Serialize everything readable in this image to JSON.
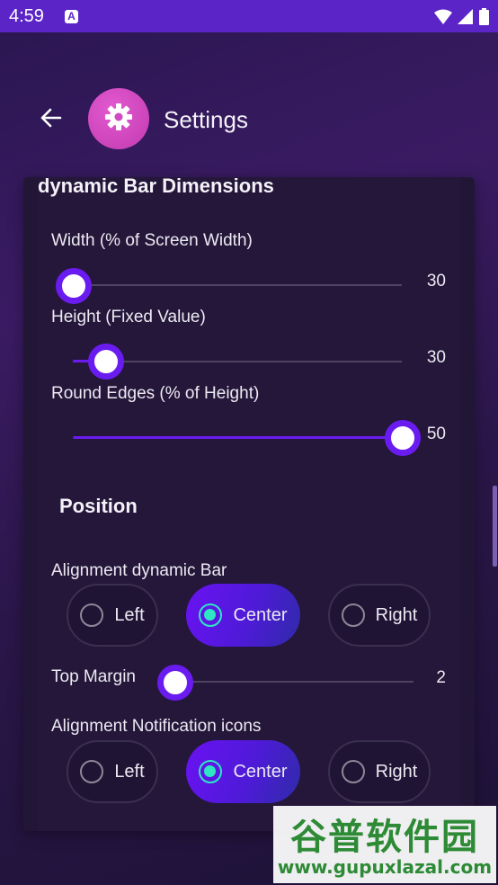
{
  "status_bar": {
    "time": "4:59",
    "notification_icon": "A"
  },
  "app_bar": {
    "title": "Settings"
  },
  "dimensions": {
    "section_title": "dynamic Bar Dimensions",
    "width": {
      "label": "Width (% of Screen Width)",
      "value": "30",
      "fraction": 0.0
    },
    "height": {
      "label": "Height (Fixed Value)",
      "value": "30",
      "fraction": 0.1
    },
    "round_edges": {
      "label": "Round Edges (% of Height)",
      "value": "50",
      "fraction": 1.0
    }
  },
  "position": {
    "section_title": "Position",
    "alignment_bar": {
      "label": "Alignment dynamic Bar",
      "options": [
        "Left",
        "Center",
        "Right"
      ],
      "selected": "Center"
    },
    "top_margin": {
      "label": "Top Margin",
      "value": "2",
      "fraction": 0.0
    },
    "alignment_icons": {
      "label": "Alignment Notification icons",
      "options": [
        "Left",
        "Center",
        "Right"
      ],
      "selected": "Center"
    }
  },
  "watermark": {
    "line1": "谷普软件园",
    "line2": "www.gupuxlazal.com"
  },
  "colors": {
    "accent": "#6a1cf0",
    "status_bar": "#5b24c7",
    "radio_selected": "#2ee6c4",
    "logo": "#d04ac0"
  },
  "icons": {
    "back": "back-arrow-icon",
    "logo": "gear-icon",
    "wifi": "wifi-icon",
    "signal": "signal-icon",
    "battery": "battery-icon"
  }
}
